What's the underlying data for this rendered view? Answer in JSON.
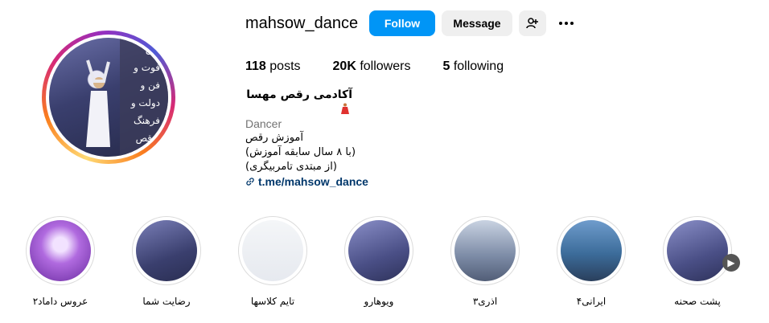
{
  "profile": {
    "username": "mahsow_dance",
    "avatar_text": "فان\nفوت و\nفن و\nدولت و\nفرهنگ\nبرقص"
  },
  "actions": {
    "follow_label": "Follow",
    "message_label": "Message",
    "add_user_icon": "person-add-icon",
    "more_icon": "more-options-icon"
  },
  "stats": {
    "posts_count": "118",
    "posts_label": "posts",
    "followers_count": "20K",
    "followers_label": "followers",
    "following_count": "5",
    "following_label": "following"
  },
  "bio": {
    "name": "آکادمی رقص مهسا",
    "category": "Dancer",
    "line1": "آموزش رقص",
    "line2": "(با ۸ سال سابقه آموزش)",
    "line3": "(از مبتدی تامربیگری)",
    "link": "t.me/mahsow_dance"
  },
  "highlights": [
    {
      "label": "عروس داماد۲",
      "theme": "#b06adf"
    },
    {
      "label": "رضایت شما",
      "theme": "#4a4f86"
    },
    {
      "label": "تایم کلاسها",
      "theme": "#eef0f4"
    },
    {
      "label": "ویوهارو",
      "theme": "#4a4f86"
    },
    {
      "label": "اذری۳",
      "theme": "#7b8aa5"
    },
    {
      "label": "ایرانی۴",
      "theme": "#3c6c9a"
    },
    {
      "label": "پشت صحنه",
      "theme": "#4a4f86"
    }
  ],
  "colors": {
    "follow_button": "#0095f6",
    "secondary_button": "#efefef",
    "link": "#00376b",
    "category": "#737373"
  }
}
